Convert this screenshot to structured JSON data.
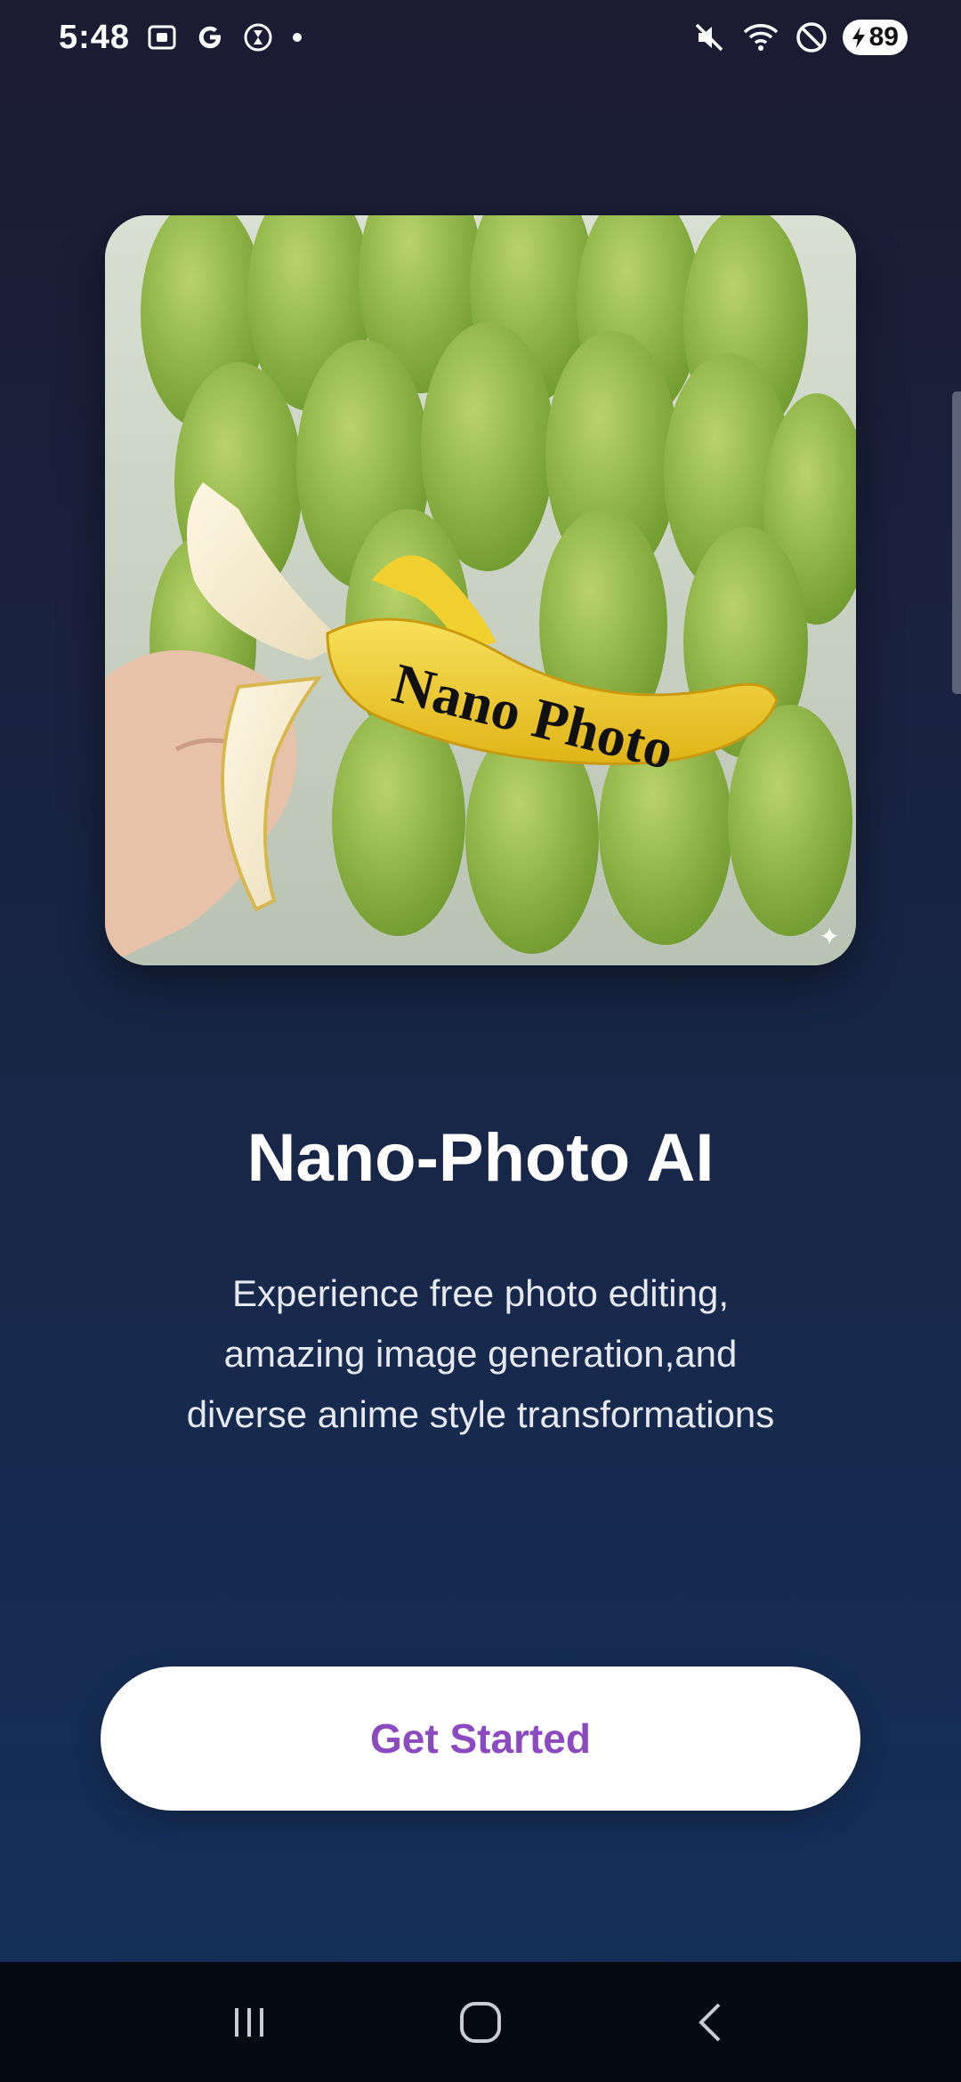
{
  "status_bar": {
    "time": "5:48",
    "battery": "89",
    "icons": [
      "screenshot-icon",
      "google-icon",
      "hourglass-icon",
      "dot-icon",
      "mute-icon",
      "wifi-icon",
      "do-not-disturb-icon",
      "battery-icon"
    ]
  },
  "hero": {
    "banana_text": "Nano Photo"
  },
  "main": {
    "title": "Nano-Photo AI",
    "subtitle_lines": [
      "Experience free photo editing,",
      "amazing image generation,and",
      "diverse anime style transformations"
    ]
  },
  "cta": {
    "label": "Get Started"
  },
  "colors": {
    "accent": "#8b4abf",
    "bg_top": "#1b1b32",
    "bg_bottom": "#14305b"
  },
  "nav_bar": {
    "items": [
      "recents-icon",
      "home-icon",
      "back-icon"
    ]
  }
}
